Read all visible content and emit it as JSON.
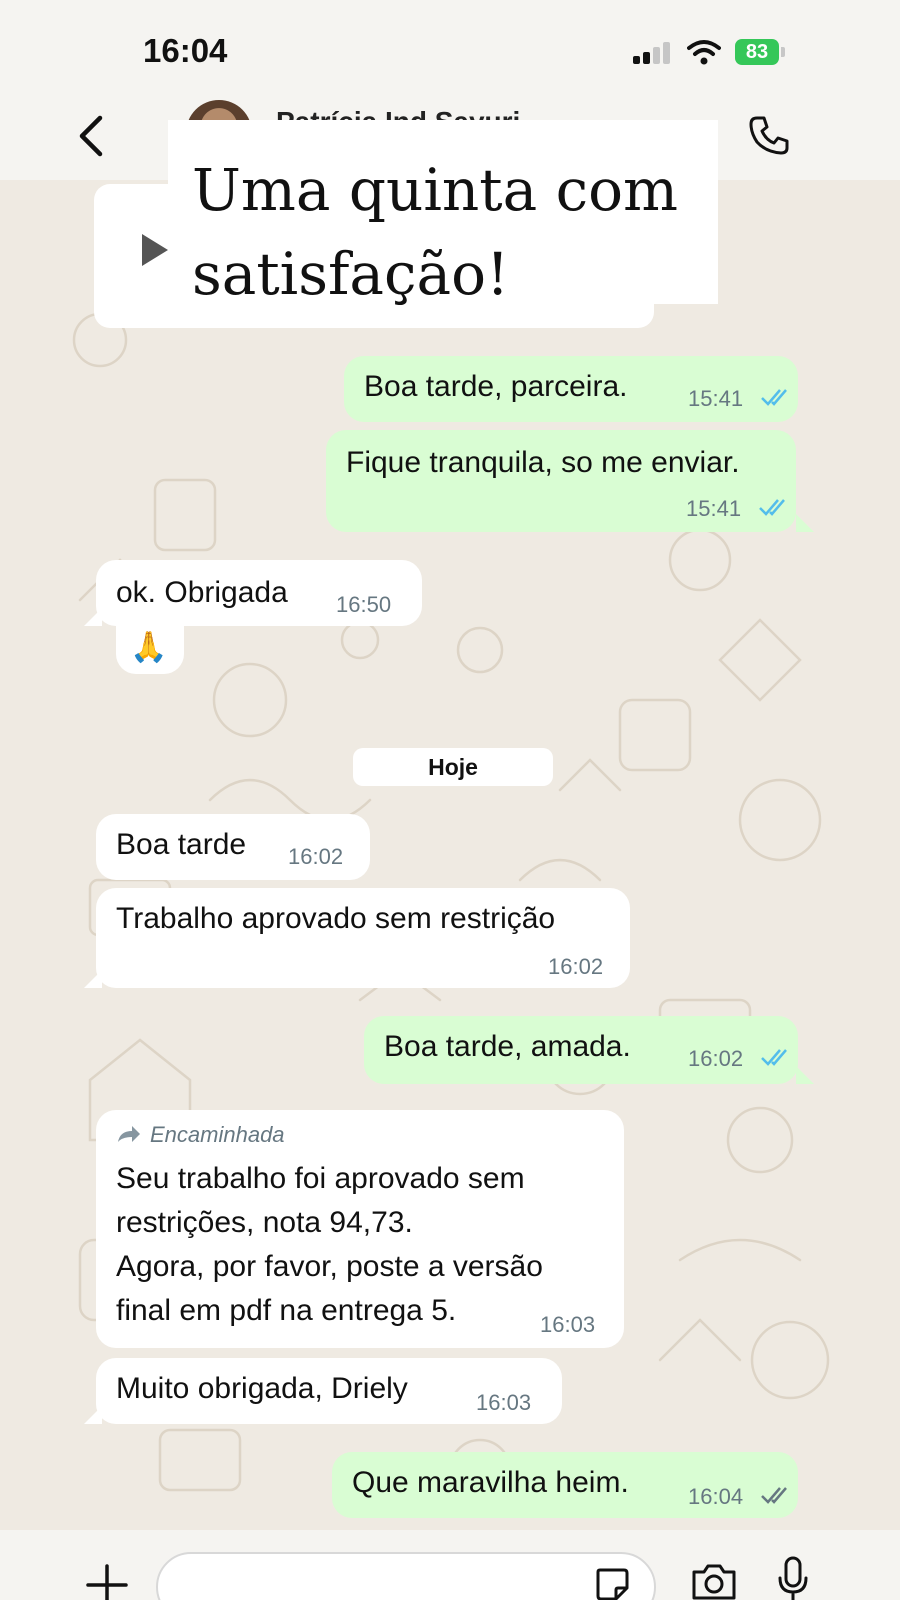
{
  "status_bar": {
    "time": "16:04",
    "battery": "83"
  },
  "header": {
    "contact_name": "Patrícia Ind Sayuri",
    "back_icon": "chevron-left-icon",
    "call_icon": "phone-icon"
  },
  "overlay": {
    "title": "Uma quinta com satisfação!",
    "play_icon": "play-icon"
  },
  "messages": [
    {
      "direction": "out",
      "text": "Boa tarde, parceira.",
      "time": "15:41",
      "status": "read"
    },
    {
      "direction": "out",
      "text": "Fique tranquila, so me enviar.",
      "time": "15:41",
      "status": "read"
    },
    {
      "direction": "in",
      "text": "ok. Obrigada",
      "emoji": "🙏",
      "time": "16:50"
    },
    {
      "direction": "in",
      "text": "Boa tarde",
      "time": "16:02"
    },
    {
      "direction": "in",
      "text": "Trabalho aprovado sem restrição",
      "time": "16:02"
    },
    {
      "direction": "out",
      "text": "Boa tarde, amada.",
      "time": "16:02",
      "status": "read"
    },
    {
      "direction": "in",
      "forwarded_label": "Encaminhada",
      "lines": [
        "Seu trabalho foi aprovado sem",
        "restrições, nota 94,73.",
        "Agora, por favor, poste a versão",
        "final em pdf na entrega 5."
      ],
      "time": "16:03"
    },
    {
      "direction": "in",
      "text": "Muito obrigada, Driely",
      "time": "16:03"
    },
    {
      "direction": "out",
      "text": "Que maravilha heim.",
      "time": "16:04",
      "status": "delivered"
    }
  ],
  "date_separator": "Hoje",
  "input_bar": {
    "message_placeholder": "",
    "icons": [
      "plus-icon",
      "sticker-icon",
      "camera-icon",
      "mic-icon"
    ]
  },
  "colors": {
    "outgoing_bubble": "#d9fdd3",
    "incoming_bubble": "#ffffff",
    "chat_background": "#efeae2",
    "read_ticks": "#53bdeb",
    "delivered_ticks": "#667781",
    "battery": "#35c759"
  }
}
